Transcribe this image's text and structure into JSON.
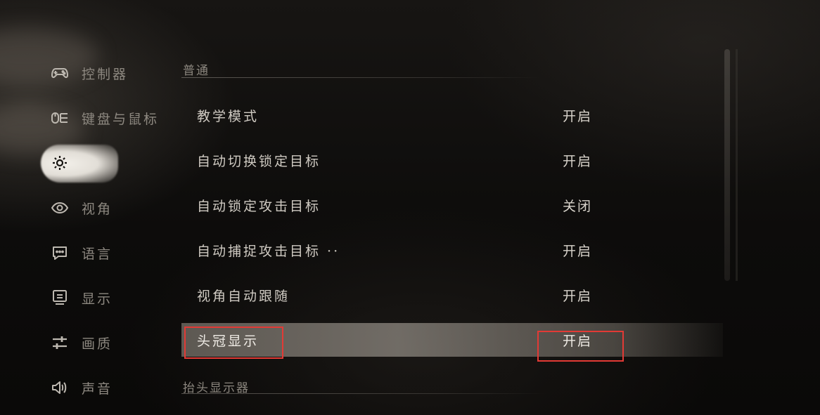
{
  "sidebar": {
    "items": [
      {
        "label": "控制器",
        "icon": "gamepad-icon"
      },
      {
        "label": "键盘与鼠标",
        "icon": "keyboard-mouse-icon"
      },
      {
        "label": "",
        "icon": "gear-icon",
        "active": true
      },
      {
        "label": "视角",
        "icon": "eye-icon"
      },
      {
        "label": "语言",
        "icon": "chat-icon"
      },
      {
        "label": "显示",
        "icon": "monitor-icon"
      },
      {
        "label": "画质",
        "icon": "sliders-icon"
      },
      {
        "label": "声音",
        "icon": "speaker-icon"
      }
    ]
  },
  "sections": {
    "top_header": "普通",
    "bottom_header": "抬头显示器"
  },
  "settings": [
    {
      "label": "教学模式",
      "value": "开启"
    },
    {
      "label": "自动切换锁定目标",
      "value": "开启"
    },
    {
      "label": "自动锁定攻击目标",
      "value": "关闭"
    },
    {
      "label": "自动捕捉攻击目标 ··",
      "value": "开启"
    },
    {
      "label": "视角自动跟随",
      "value": "开启"
    },
    {
      "label": "头冠显示",
      "value": "开启",
      "selected": true
    }
  ],
  "colors": {
    "highlight_box": "#e23a35",
    "active_blob": "#f2efe9"
  }
}
